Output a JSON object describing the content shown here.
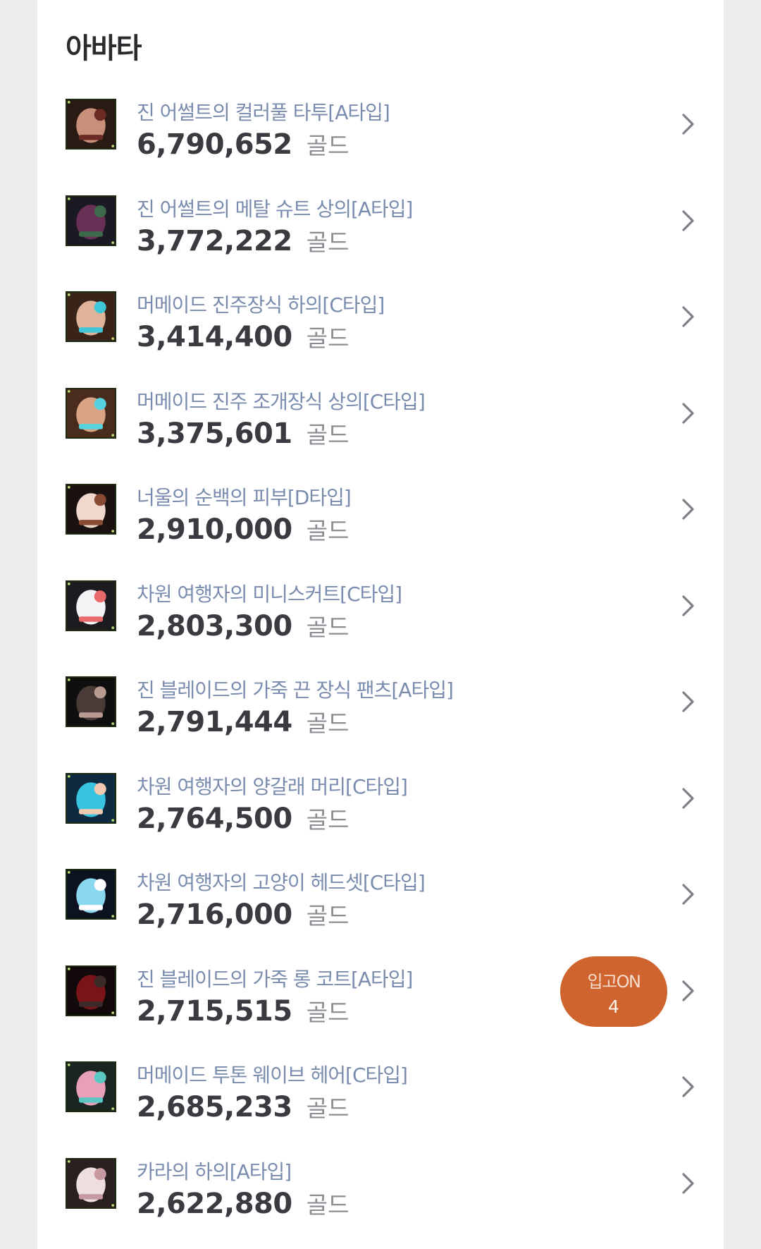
{
  "section": {
    "title": "아바타"
  },
  "items": [
    {
      "name": "진 어썰트의 컬러풀 타투[A타입]",
      "price": "6,790,652",
      "unit": "골드",
      "icon": "avatar-tattoo-icon",
      "colors": [
        "#2a1a14",
        "#c8907a",
        "#6b2a24"
      ]
    },
    {
      "name": "진 어썰트의 메탈 슈트 상의[A타입]",
      "price": "3,772,222",
      "unit": "골드",
      "icon": "avatar-metal-suit-icon",
      "colors": [
        "#1b1a24",
        "#6a2f55",
        "#3d6a4a"
      ]
    },
    {
      "name": "머메이드 진주장식 하의[C타입]",
      "price": "3,414,400",
      "unit": "골드",
      "icon": "avatar-pearl-bottom-icon",
      "colors": [
        "#3a241a",
        "#e0b49a",
        "#3fc6d8"
      ]
    },
    {
      "name": "머메이드 진주 조개장식 상의[C타입]",
      "price": "3,375,601",
      "unit": "골드",
      "icon": "avatar-pearl-top-icon",
      "colors": [
        "#4a2c1c",
        "#d9a486",
        "#55d1e0"
      ]
    },
    {
      "name": "너울의 순백의 피부[D타입]",
      "price": "2,910,000",
      "unit": "골드",
      "icon": "avatar-skin-icon",
      "colors": [
        "#1a1210",
        "#f1d8cc",
        "#8a4b33"
      ]
    },
    {
      "name": "차원 여행자의 미니스커트[C타입]",
      "price": "2,803,300",
      "unit": "골드",
      "icon": "avatar-miniskirt-icon",
      "colors": [
        "#1c1c20",
        "#f4f4f6",
        "#e86a6a"
      ]
    },
    {
      "name": "진 블레이드의 가죽 끈 장식 팬츠[A타입]",
      "price": "2,791,444",
      "unit": "골드",
      "icon": "avatar-leather-pants-icon",
      "colors": [
        "#0f0f10",
        "#4a3a38",
        "#b89a90"
      ]
    },
    {
      "name": "차원 여행자의 양갈래 머리[C타입]",
      "price": "2,764,500",
      "unit": "골드",
      "icon": "avatar-twintail-hair-icon",
      "colors": [
        "#0e2a40",
        "#38c4e0",
        "#f2c8b0"
      ]
    },
    {
      "name": "차원 여행자의 고양이 헤드셋[C타입]",
      "price": "2,716,000",
      "unit": "골드",
      "icon": "avatar-cat-headset-icon",
      "colors": [
        "#0c1220",
        "#8ad8f0",
        "#ffffff"
      ]
    },
    {
      "name": "진 블레이드의 가죽 롱 코트[A타입]",
      "price": "2,715,515",
      "unit": "골드",
      "icon": "avatar-long-coat-icon",
      "colors": [
        "#120a0a",
        "#7a1418",
        "#3a2a28"
      ],
      "badge": {
        "label": "입고ON",
        "count": "4"
      }
    },
    {
      "name": "머메이드 투톤 웨이브 헤어[C타입]",
      "price": "2,685,233",
      "unit": "골드",
      "icon": "avatar-wave-hair-icon",
      "colors": [
        "#1a2420",
        "#e8a0b8",
        "#5ac8c0"
      ]
    },
    {
      "name": "카라의 하의[A타입]",
      "price": "2,622,880",
      "unit": "골드",
      "icon": "avatar-kara-bottom-icon",
      "colors": [
        "#2a2020",
        "#eedede",
        "#c69aa0"
      ]
    }
  ]
}
